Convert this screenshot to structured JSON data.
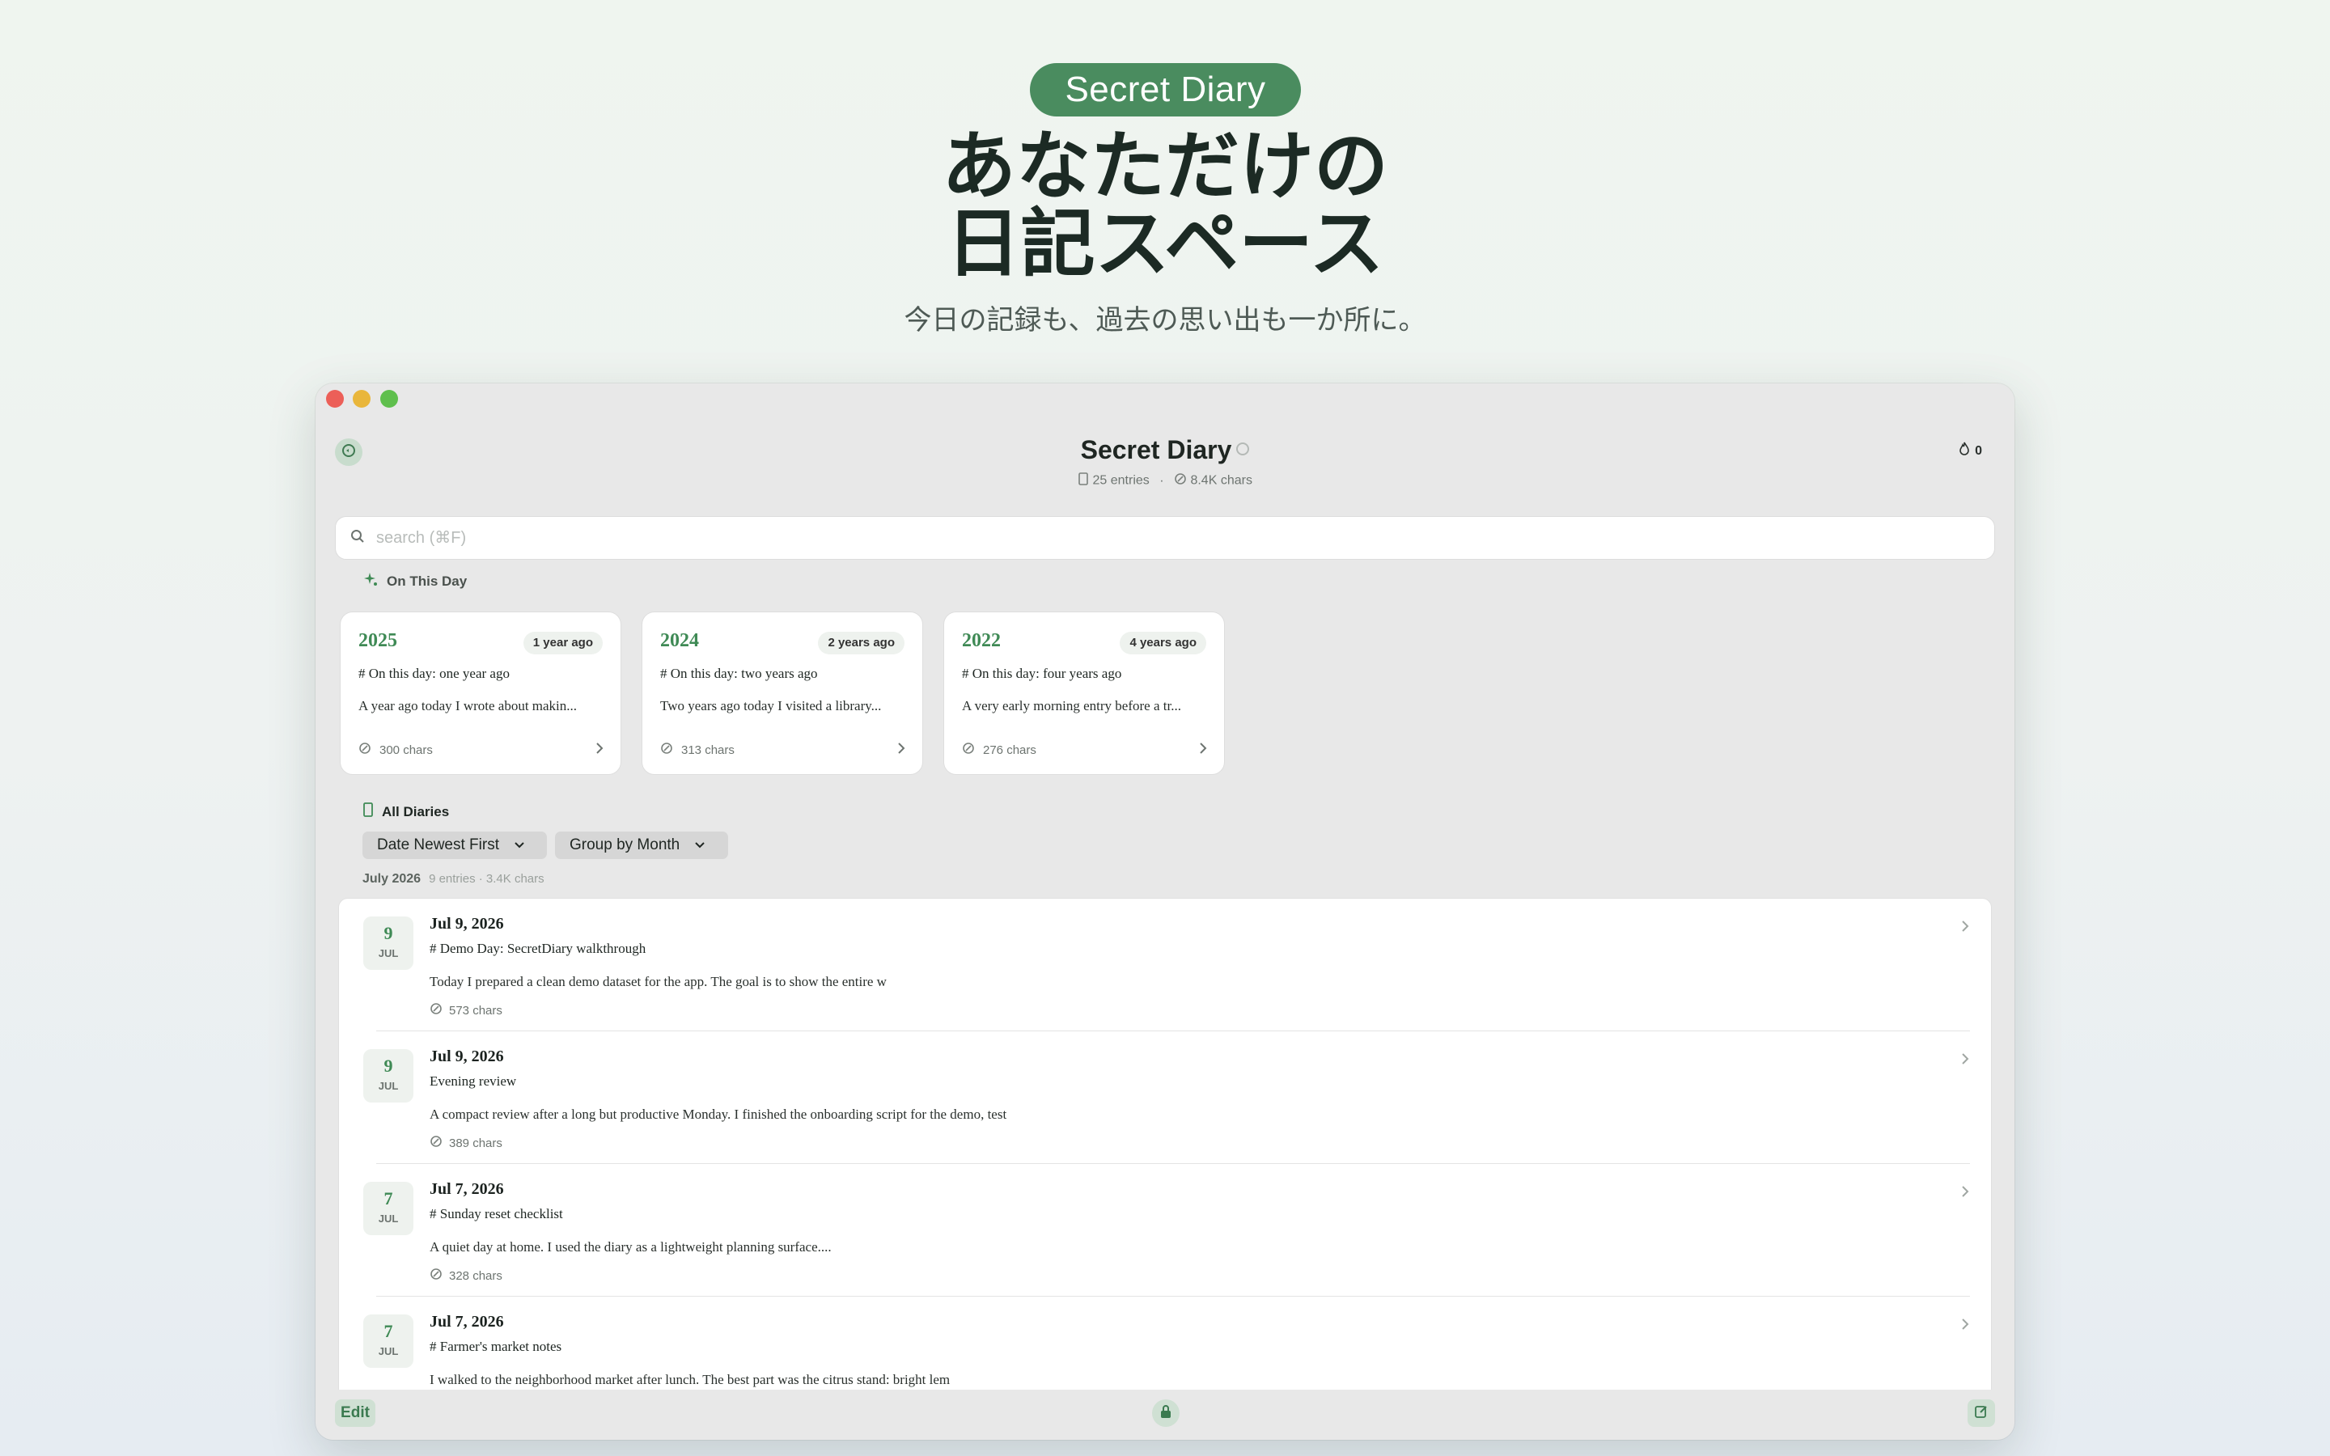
{
  "hero": {
    "badge": "Secret Diary",
    "title_line1": "あなただけの",
    "title_line2": "日記スペース",
    "subtitle": "今日の記録も、過去の思い出も一か所に。"
  },
  "app": {
    "title": "Secret Diary",
    "entries_count": "25 entries",
    "stats_separator": "·",
    "chars_count": "8.4K chars",
    "streak_value": "0"
  },
  "search": {
    "placeholder": "search (⌘F)"
  },
  "on_this_day": {
    "label": "On This Day",
    "cards": [
      {
        "year": "2025",
        "ago": "1 year ago",
        "title": "# On this day: one year ago",
        "excerpt": "A year ago today I wrote about makin...",
        "chars": "300 chars"
      },
      {
        "year": "2024",
        "ago": "2 years ago",
        "title": "# On this day: two years ago",
        "excerpt": "Two years ago today I visited a library...",
        "chars": "313 chars"
      },
      {
        "year": "2022",
        "ago": "4 years ago",
        "title": "# On this day: four years ago",
        "excerpt": "A very early morning entry before a tr...",
        "chars": "276 chars"
      }
    ]
  },
  "all_diaries": {
    "label": "All Diaries",
    "sort_label": "Date Newest First",
    "group_label": "Group by Month",
    "month": "July 2026",
    "month_meta": "9 entries · 3.4K chars",
    "entries": [
      {
        "day": "9",
        "month": "JUL",
        "date": "Jul 9, 2026",
        "title": "# Demo Day: SecretDiary walkthrough",
        "excerpt": "Today I prepared a clean demo dataset for the app. The goal is to show the entire w",
        "chars": "573 chars"
      },
      {
        "day": "9",
        "month": "JUL",
        "date": "Jul 9, 2026",
        "title": "Evening review",
        "excerpt": "A compact review after a long but productive Monday. I finished the onboarding script for the demo, test",
        "chars": "389 chars"
      },
      {
        "day": "7",
        "month": "JUL",
        "date": "Jul 7, 2026",
        "title": "# Sunday reset checklist",
        "excerpt": "A quiet day at home. I used the diary as a lightweight planning surface....",
        "chars": "328 chars"
      },
      {
        "day": "7",
        "month": "JUL",
        "date": "Jul 7, 2026",
        "title": "# Farmer's market notes",
        "excerpt": "I walked to the neighborhood market after lunch. The best part was the citrus stand: bright lem",
        "chars": ""
      }
    ]
  },
  "bottom": {
    "edit_label": "Edit"
  },
  "colors": {
    "accent": "#3f8a55",
    "badge_bg": "#4a8c5f",
    "window_bg": "#e8e8e8"
  },
  "icons": [
    "shield-check-icon",
    "info-icon",
    "book-icon",
    "char-count-icon",
    "flame-icon",
    "search-icon",
    "sparkle-icon",
    "chevron-right-icon",
    "chevron-down-icon",
    "lock-icon",
    "compose-icon"
  ]
}
